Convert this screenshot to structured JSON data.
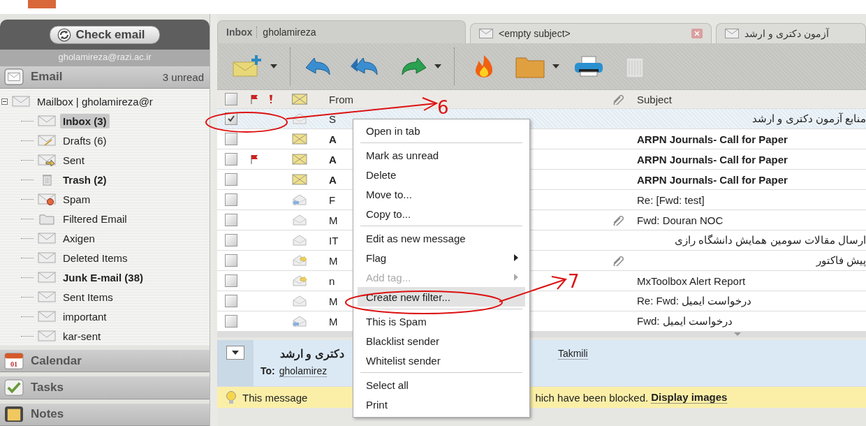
{
  "sidebar": {
    "check_button": "Check email",
    "account": "gholamireza@razi.ac.ir",
    "email_section": {
      "label": "Email",
      "unread": "3 unread"
    },
    "tree": [
      {
        "label": "Mailbox | gholamireza@r",
        "kind": "envelope",
        "expanded": true,
        "children": [
          {
            "label": "Inbox (3)",
            "kind": "envelope",
            "bold": true,
            "selected": true
          },
          {
            "label": "Drafts (6)",
            "kind": "drafts",
            "bold": false,
            "selected": false
          },
          {
            "label": "Sent",
            "kind": "sent",
            "bold": false,
            "selected": false
          },
          {
            "label": "Trash (2)",
            "kind": "trash",
            "bold": true,
            "selected": false
          },
          {
            "label": "Spam",
            "kind": "spam",
            "bold": false,
            "selected": false
          },
          {
            "label": "Filtered Email",
            "kind": "folder",
            "bold": false,
            "selected": false
          },
          {
            "label": "Axigen",
            "kind": "envelope",
            "bold": false,
            "selected": false
          },
          {
            "label": "Deleted Items",
            "kind": "envelope",
            "bold": false,
            "selected": false
          },
          {
            "label": "Junk E-mail (38)",
            "kind": "envelope",
            "bold": true,
            "selected": false
          },
          {
            "label": "Sent Items",
            "kind": "envelope",
            "bold": false,
            "selected": false
          },
          {
            "label": "important",
            "kind": "envelope",
            "bold": false,
            "selected": false
          },
          {
            "label": "kar-sent",
            "kind": "envelope",
            "bold": false,
            "selected": false
          }
        ]
      }
    ],
    "sections": [
      {
        "label": "Calendar",
        "kind": "calendar",
        "day": "01"
      },
      {
        "label": "Tasks",
        "kind": "tasks"
      },
      {
        "label": "Notes",
        "kind": "notes"
      }
    ]
  },
  "tabs": [
    {
      "kind": "folder",
      "label": "Inbox",
      "account": "gholamireza",
      "selected": true
    },
    {
      "kind": "message",
      "label": "<empty subject>",
      "selected": false,
      "closable": true
    },
    {
      "kind": "message",
      "label": "آزمون دکتری و ارشد",
      "selected": false,
      "closable": false
    }
  ],
  "toolbar": [
    {
      "kind": "compose",
      "dropdown": true,
      "enabled": true
    },
    {
      "kind": "reply",
      "dropdown": false,
      "enabled": true
    },
    {
      "kind": "reply-all",
      "dropdown": false,
      "enabled": true
    },
    {
      "kind": "forward",
      "dropdown": true,
      "enabled": true
    },
    {
      "kind": "spam",
      "dropdown": false,
      "enabled": true
    },
    {
      "kind": "move",
      "dropdown": true,
      "enabled": true
    },
    {
      "kind": "print",
      "dropdown": false,
      "enabled": true
    },
    {
      "kind": "delete",
      "dropdown": false,
      "enabled": false
    }
  ],
  "table": {
    "select_all": {
      "checked": false
    },
    "columns": {
      "from": "From",
      "subject": "Subject"
    },
    "rows": [
      {
        "checked": true,
        "selected": true,
        "flagged": false,
        "kind": "read",
        "from": "S",
        "attachment": false,
        "subject": "منابع آزمون دکتری و ارشد",
        "bold": false
      },
      {
        "checked": false,
        "selected": false,
        "flagged": false,
        "kind": "unread",
        "from": "A",
        "attachment": false,
        "subject": "ARPN Journals- Call for Paper",
        "bold": true
      },
      {
        "checked": false,
        "selected": false,
        "flagged": true,
        "kind": "unread",
        "from": "A",
        "attachment": false,
        "subject": "ARPN Journals- Call for Paper",
        "bold": true
      },
      {
        "checked": false,
        "selected": false,
        "flagged": false,
        "kind": "unread",
        "from": "A",
        "attachment": false,
        "subject": "ARPN Journals- Call for Paper",
        "bold": true
      },
      {
        "checked": false,
        "selected": false,
        "flagged": false,
        "kind": "replied",
        "from": "F",
        "attachment": false,
        "subject": "Re: [Fwd: test]",
        "bold": false
      },
      {
        "checked": false,
        "selected": false,
        "flagged": false,
        "kind": "read",
        "from": "M",
        "attachment": true,
        "subject": "Fwd: Douran NOC",
        "bold": false
      },
      {
        "checked": false,
        "selected": false,
        "flagged": false,
        "kind": "read",
        "from": "IT",
        "attachment": false,
        "subject": "ارسال مقالات سومین همایش دانشگاه رازی",
        "bold": false
      },
      {
        "checked": false,
        "selected": false,
        "flagged": false,
        "kind": "forwarded",
        "from": "M",
        "attachment": true,
        "subject": "پیش فاکتور",
        "bold": false
      },
      {
        "checked": false,
        "selected": false,
        "flagged": false,
        "kind": "forwarded",
        "from": "n",
        "attachment": false,
        "subject": "MxToolbox Alert Report",
        "bold": false
      },
      {
        "checked": false,
        "selected": false,
        "flagged": false,
        "kind": "read",
        "from": "M",
        "attachment": false,
        "subject": "Re: Fwd: درخواست ایمیل",
        "bold": false
      },
      {
        "checked": false,
        "selected": false,
        "flagged": false,
        "kind": "replied",
        "from": "M",
        "attachment": false,
        "subject": "Fwd: درخواست ایمیل",
        "bold": false
      }
    ]
  },
  "context_menu": [
    {
      "kind": "item",
      "label": "Open in tab",
      "disabled": false,
      "submenu": false,
      "selected": false
    },
    {
      "kind": "separator"
    },
    {
      "kind": "item",
      "label": "Mark as unread",
      "disabled": false,
      "submenu": false,
      "selected": false
    },
    {
      "kind": "item",
      "label": "Delete",
      "disabled": false,
      "submenu": false,
      "selected": false
    },
    {
      "kind": "item",
      "label": "Move to...",
      "disabled": false,
      "submenu": false,
      "selected": false
    },
    {
      "kind": "item",
      "label": "Copy to...",
      "disabled": false,
      "submenu": false,
      "selected": false
    },
    {
      "kind": "separator"
    },
    {
      "kind": "item",
      "label": "Edit as new message",
      "disabled": false,
      "submenu": false,
      "selected": false
    },
    {
      "kind": "item",
      "label": "Flag",
      "disabled": false,
      "submenu": true,
      "selected": false
    },
    {
      "kind": "item",
      "label": "Add tag...",
      "disabled": true,
      "submenu": true,
      "selected": false
    },
    {
      "kind": "item",
      "label": "Create new filter...",
      "disabled": false,
      "submenu": false,
      "selected": true
    },
    {
      "kind": "separator"
    },
    {
      "kind": "item",
      "label": "This is Spam",
      "disabled": false,
      "submenu": false,
      "selected": false
    },
    {
      "kind": "item",
      "label": "Blacklist sender",
      "disabled": false,
      "submenu": false,
      "selected": false
    },
    {
      "kind": "item",
      "label": "Whitelist sender",
      "disabled": false,
      "submenu": false,
      "selected": false
    },
    {
      "kind": "separator"
    },
    {
      "kind": "item",
      "label": "Select all",
      "disabled": false,
      "submenu": false,
      "selected": false
    },
    {
      "kind": "item",
      "label": "Print",
      "disabled": false,
      "submenu": false,
      "selected": false
    }
  ],
  "reading_pane": {
    "subject": "دکتری و ارشد",
    "from": "Takmili",
    "to_label": "To:",
    "to": "gholamirez",
    "notice": {
      "before": "This message",
      "after": "hich have been blocked.",
      "link": "Display images"
    }
  },
  "annotations": [
    {
      "number": "6"
    },
    {
      "number": "7"
    }
  ]
}
